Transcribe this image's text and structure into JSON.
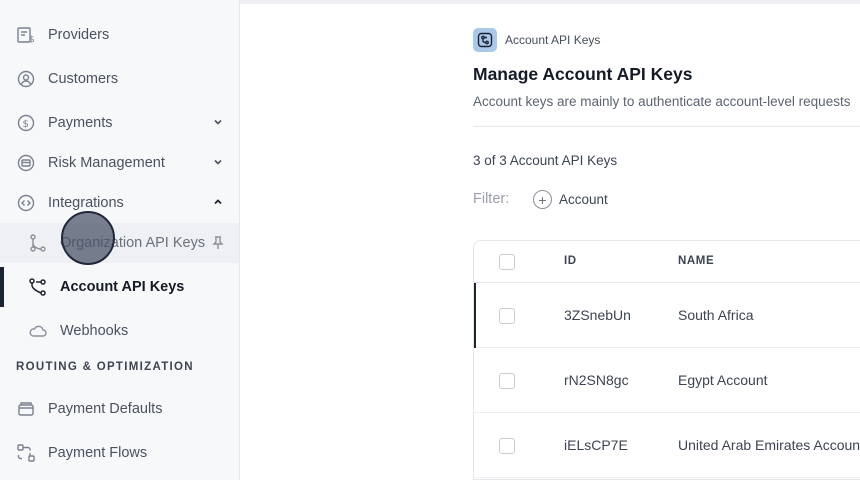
{
  "sidebar": {
    "items": [
      {
        "label": "Providers",
        "icon": "providers-icon"
      },
      {
        "label": "Customers",
        "icon": "customers-icon"
      },
      {
        "label": "Payments",
        "icon": "payments-icon"
      },
      {
        "label": "Risk Management",
        "icon": "risk-icon"
      },
      {
        "label": "Integrations",
        "icon": "integrations-icon"
      }
    ],
    "sub_items": [
      {
        "label": "Organization API Keys",
        "icon": "branch-icon"
      },
      {
        "label": "Account API Keys",
        "icon": "account-keys-icon"
      },
      {
        "label": "Webhooks",
        "icon": "cloud-icon"
      }
    ],
    "section_heading": "ROUTING & OPTIMIZATION",
    "section_items": [
      {
        "label": "Payment Defaults",
        "icon": "payment-defaults-icon"
      },
      {
        "label": "Payment Flows",
        "icon": "payment-flows-icon"
      }
    ]
  },
  "main": {
    "breadcrumb": "Account API Keys",
    "title": "Manage Account API Keys",
    "description": "Account keys are mainly to authenticate account-level requests",
    "count_text": "3 of 3 Account API Keys",
    "filter_label": "Filter:",
    "filter_button": "Account",
    "table": {
      "columns": [
        "ID",
        "NAME"
      ],
      "rows": [
        {
          "id": "3ZSnebUn",
          "name": "South Africa"
        },
        {
          "id": "rN2SN8gc",
          "name": "Egypt Account"
        },
        {
          "id": "iELsCP7E",
          "name": "United Arab Emirates Account"
        }
      ]
    }
  },
  "colors": {
    "active_indicator": "#1b2333",
    "badge_bg": "#a9c8ea",
    "sidebar_bg": "#f7f8fa"
  }
}
